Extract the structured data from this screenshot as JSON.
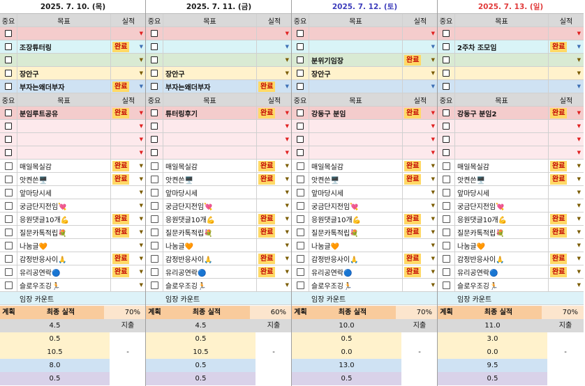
{
  "labels": {
    "importance": "중요",
    "goal": "목표",
    "result": "실적",
    "plan": "계획",
    "final_result": "최종 실적",
    "expense": "지출",
    "dash": "-",
    "done": "완료"
  },
  "colors": {
    "pink": "#f4cccc",
    "lightpink": "#fde9ec",
    "cyan": "#d9f4f7",
    "green": "#d9ead3",
    "yellow": "#fff2cc",
    "blue": "#cfe2f3",
    "header": "#d9d9d9",
    "count_row": "#ddf2f8",
    "done_bg": "#ffd966",
    "done_text": "#c00000"
  },
  "days": [
    {
      "date": "2025. 7. 10. (목)",
      "date_color": "#1a1a1a",
      "top": [
        {
          "goal": "",
          "done": false
        },
        {
          "goal": "조장튜터링",
          "done": true
        },
        {
          "goal": "",
          "done": false
        },
        {
          "goal": "장안구",
          "done": false
        },
        {
          "goal": "부자는왜더부자",
          "done": true
        }
      ],
      "mid": [
        {
          "goal": "분임루트공유",
          "done": true
        },
        {
          "goal": "",
          "done": false
        },
        {
          "goal": "",
          "done": false
        },
        {
          "goal": "",
          "done": false
        }
      ],
      "habits": [
        {
          "goal": "매일목실감",
          "done": true
        },
        {
          "goal": "앗켠쓴🖥️",
          "done": true
        },
        {
          "goal": "앞마당시세",
          "done": false
        },
        {
          "goal": "궁금단지전임💘",
          "done": false
        },
        {
          "goal": "응원댓글10개💪",
          "done": true
        },
        {
          "goal": "질문카톡적립💐",
          "done": true
        },
        {
          "goal": "나눔글🧡",
          "done": false
        },
        {
          "goal": "감정반응사이🙏",
          "done": true
        },
        {
          "goal": "유리공연락🔵",
          "done": true
        },
        {
          "goal": "슬로우조깅🏃",
          "done": false
        }
      ],
      "count_label": "임장 카운트",
      "rate": "70%",
      "plans": [
        "4.5",
        "0.5",
        "10.5",
        "8.0",
        "0.5"
      ]
    },
    {
      "date": "2025. 7. 11. (금)",
      "date_color": "#1a1a1a",
      "top": [
        {
          "goal": "",
          "done": false
        },
        {
          "goal": "",
          "done": false
        },
        {
          "goal": "",
          "done": false
        },
        {
          "goal": "장안구",
          "done": false
        },
        {
          "goal": "부자는왜더부자",
          "done": true
        }
      ],
      "mid": [
        {
          "goal": "튜터링후기",
          "done": true
        },
        {
          "goal": "",
          "done": false
        },
        {
          "goal": "",
          "done": false
        },
        {
          "goal": "",
          "done": false
        }
      ],
      "habits": [
        {
          "goal": "매일목실감",
          "done": true
        },
        {
          "goal": "앗켠쓴🖥️",
          "done": true
        },
        {
          "goal": "앞마당시세",
          "done": false
        },
        {
          "goal": "궁금단지전임💘",
          "done": false
        },
        {
          "goal": "응원댓글10개💪",
          "done": true
        },
        {
          "goal": "질문카톡적립💐",
          "done": true
        },
        {
          "goal": "나눔글🧡",
          "done": false
        },
        {
          "goal": "감정반응사이🙏",
          "done": true
        },
        {
          "goal": "유리공연락🔵",
          "done": true
        },
        {
          "goal": "슬로우조깅🏃",
          "done": false
        }
      ],
      "count_label": "임장 카운트",
      "rate": "60%",
      "plans": [
        "4.5",
        "0.5",
        "10.5",
        "0.5",
        "0.5"
      ]
    },
    {
      "date": "2025. 7. 12. (토)",
      "date_color": "#3d3dbb",
      "top": [
        {
          "goal": "",
          "done": false
        },
        {
          "goal": "",
          "done": false
        },
        {
          "goal": "분위기임장",
          "done": true
        },
        {
          "goal": "장안구",
          "done": false
        },
        {
          "goal": "",
          "done": false
        }
      ],
      "mid": [
        {
          "goal": "강동구 분임",
          "done": true
        },
        {
          "goal": "",
          "done": false
        },
        {
          "goal": "",
          "done": false
        },
        {
          "goal": "",
          "done": false
        }
      ],
      "habits": [
        {
          "goal": "매일목실감",
          "done": true
        },
        {
          "goal": "앗켠쓴🖥️",
          "done": true
        },
        {
          "goal": "앞마당시세",
          "done": false
        },
        {
          "goal": "궁금단지전임💘",
          "done": false
        },
        {
          "goal": "응원댓글10개💪",
          "done": true
        },
        {
          "goal": "질문카톡적립💐",
          "done": true
        },
        {
          "goal": "나눔글🧡",
          "done": false
        },
        {
          "goal": "감정반응사이🙏",
          "done": true
        },
        {
          "goal": "유리공연락🔵",
          "done": true
        },
        {
          "goal": "슬로우조깅🏃",
          "done": false
        }
      ],
      "count_label": "임장 카운트",
      "rate": "70%",
      "plans": [
        "10.0",
        "0.5",
        "0.0",
        "13.0",
        "0.5"
      ]
    },
    {
      "date": "2025. 7. 13. (일)",
      "date_color": "#e03a3a",
      "top": [
        {
          "goal": "",
          "done": false
        },
        {
          "goal": "2주차 조모임",
          "done": true
        },
        {
          "goal": "",
          "done": false
        },
        {
          "goal": "",
          "done": false
        },
        {
          "goal": "",
          "done": false
        }
      ],
      "mid": [
        {
          "goal": "강동구 분임2",
          "done": true
        },
        {
          "goal": "",
          "done": false
        },
        {
          "goal": "",
          "done": false
        },
        {
          "goal": "",
          "done": false
        }
      ],
      "habits": [
        {
          "goal": "매일목실감",
          "done": true
        },
        {
          "goal": "앗켠쓴🖥️",
          "done": true
        },
        {
          "goal": "앞마당시세",
          "done": false
        },
        {
          "goal": "궁금단지전임💘",
          "done": false
        },
        {
          "goal": "응원댓글10개💪",
          "done": true
        },
        {
          "goal": "질문카톡적립💐",
          "done": true
        },
        {
          "goal": "나눔글🧡",
          "done": false
        },
        {
          "goal": "감정반응사이🙏",
          "done": true
        },
        {
          "goal": "유리공연락🔵",
          "done": true
        },
        {
          "goal": "슬로우조깅🏃",
          "done": false
        }
      ],
      "count_label": "임장 카운트",
      "rate": "70%",
      "plans": [
        "11.0",
        "3.0",
        "0.0",
        "9.5",
        "0.5"
      ]
    }
  ]
}
